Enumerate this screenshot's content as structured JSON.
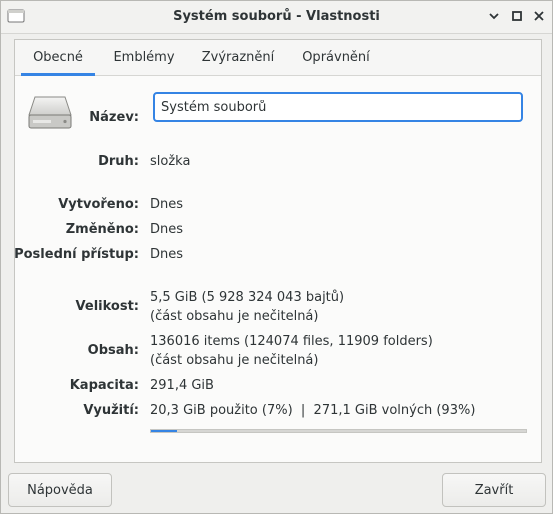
{
  "window": {
    "title": "Systém souborů - Vlastnosti"
  },
  "tabs": [
    {
      "label": "Obecné",
      "active": true
    },
    {
      "label": "Emblémy",
      "active": false
    },
    {
      "label": "Zvýraznění",
      "active": false
    },
    {
      "label": "Oprávnění",
      "active": false
    }
  ],
  "general": {
    "name_label": "Název:",
    "name_value": "Systém souborů",
    "kind_label": "Druh:",
    "kind_value": "složka",
    "created_label": "Vytvořeno:",
    "created_value": "Dnes",
    "modified_label": "Změněno:",
    "modified_value": "Dnes",
    "accessed_label": "Poslední přístup:",
    "accessed_value": "Dnes",
    "size_label": "Velikost:",
    "size_value": "5,5 GiB (5 928 324 043 bajtů)",
    "size_note": "(část obsahu je nečitelná)",
    "contents_label": "Obsah:",
    "contents_value": "136016 items (124074 files, 11909 folders)",
    "contents_note": "(část obsahu je nečitelná)",
    "capacity_label": "Kapacita:",
    "capacity_value": "291,4 GiB",
    "usage_label": "Využití:",
    "usage_value": "20,3 GiB použito (7%)  |  271,1 GiB volných (93%)",
    "usage_fraction": 0.07
  },
  "footer": {
    "help_label": "Nápověda",
    "close_label": "Zavřít"
  },
  "colors": {
    "accent": "#3584e4"
  },
  "icons": {
    "app": "window-app-icon",
    "drive": "hard-drive-icon"
  }
}
